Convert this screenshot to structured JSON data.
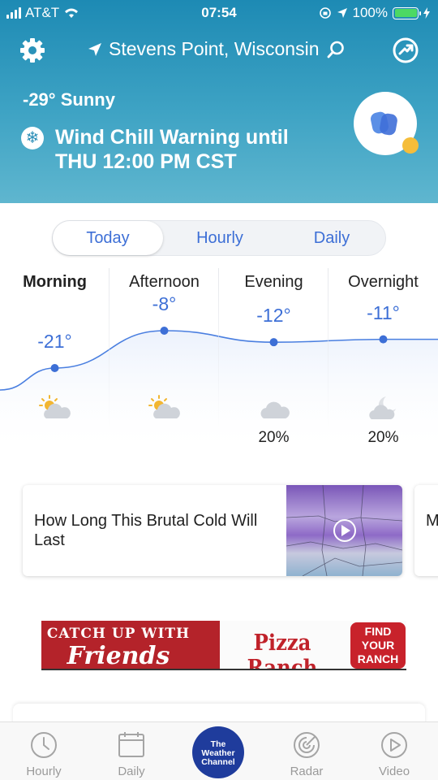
{
  "status_bar": {
    "carrier": "AT&T",
    "time": "07:54",
    "battery": "100%"
  },
  "header": {
    "location": "Stevens Point, Wisconsin",
    "current_conditions": "-29° Sunny",
    "alert_line1": "Wind Chill Warning until",
    "alert_line2": "THU 12:00 PM CST",
    "icons": {
      "settings": "gear-icon",
      "location": "location-arrow-icon",
      "search": "search-icon",
      "share": "share-icon",
      "alert": "snowflake-icon"
    }
  },
  "tabs": [
    {
      "label": "Today",
      "active": true
    },
    {
      "label": "Hourly",
      "active": false
    },
    {
      "label": "Daily",
      "active": false
    }
  ],
  "forecast": {
    "periods": [
      {
        "label": "Morning",
        "temp": "-21°",
        "temp_value": -21,
        "icon": "partly-sunny-icon",
        "precip": ""
      },
      {
        "label": "Afternoon",
        "temp": "-8°",
        "temp_value": -8,
        "icon": "partly-sunny-icon",
        "precip": ""
      },
      {
        "label": "Evening",
        "temp": "-12°",
        "temp_value": -12,
        "icon": "cloud-icon",
        "precip": "20%"
      },
      {
        "label": "Overnight",
        "temp": "-11°",
        "temp_value": -11,
        "icon": "partly-cloudy-night-icon",
        "precip": "20%"
      }
    ]
  },
  "news": {
    "title": "How Long This Brutal Cold Will Last",
    "next_title_peek": "M ex"
  },
  "ad": {
    "line1": "CATCH UP WITH",
    "line2": "Friends",
    "brand": "Pizza Ranch",
    "cta_line1": "FIND",
    "cta_line2": "YOUR",
    "cta_line3": "RANCH"
  },
  "bottom_nav": {
    "hourly": "Hourly",
    "daily": "Daily",
    "logo_line1": "The",
    "logo_line2": "Weather",
    "logo_line3": "Channel",
    "radar": "Radar",
    "video": "Video"
  },
  "colors": {
    "accent": "#3d6fd6",
    "header_top": "#1d8ab4",
    "header_bottom": "#5fb6cf",
    "brand_navy": "#1f3c9c"
  }
}
